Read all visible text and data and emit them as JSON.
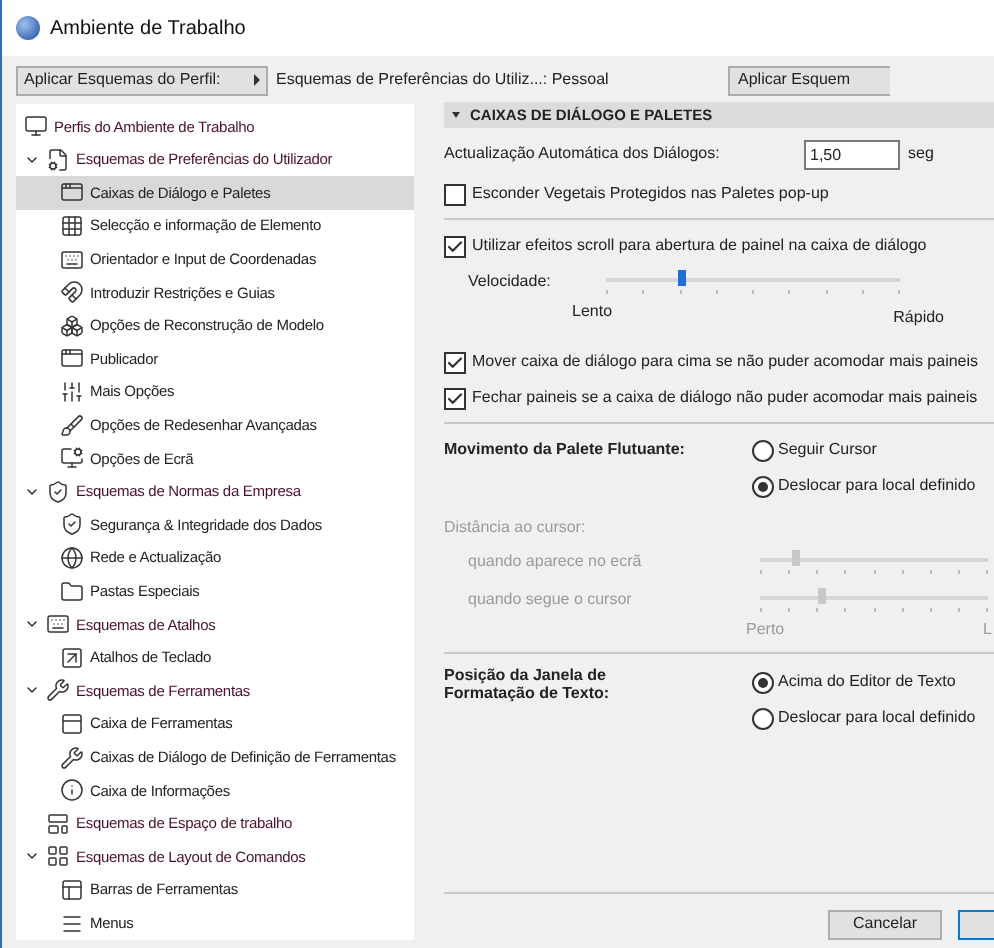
{
  "window": {
    "title": "Ambiente de Trabalho"
  },
  "toolbar": {
    "apply_menu": "Aplicar Esquemas do Perfil:",
    "scheme_path": "Esquemas de Preferências do Utiliz...: Pessoal",
    "apply_button": "Aplicar Esquem"
  },
  "tree": [
    {
      "label": "Perfis do Ambiente de Trabalho",
      "selected": false
    },
    {
      "label": "Esquemas de Preferências do Utilizador",
      "selected": false,
      "expanded": true,
      "children": [
        {
          "label": "Caixas de Diálogo e Paletes",
          "selected": true
        },
        {
          "label": "Selecção e informação de Elemento",
          "selected": false
        },
        {
          "label": "Orientador e Input de Coordenadas",
          "selected": false
        },
        {
          "label": "Introduzir Restrições e Guias",
          "selected": false
        },
        {
          "label": "Opções de Reconstrução de Modelo",
          "selected": false
        },
        {
          "label": "Publicador",
          "selected": false
        },
        {
          "label": "Mais Opções",
          "selected": false
        },
        {
          "label": "Opções de Redesenhar Avançadas",
          "selected": false
        },
        {
          "label": "Opções de Ecrã",
          "selected": false
        }
      ]
    },
    {
      "label": "Esquemas de Normas da Empresa",
      "selected": false,
      "expanded": true,
      "children": [
        {
          "label": "Segurança & Integridade dos Dados",
          "selected": false
        },
        {
          "label": "Rede e Actualização",
          "selected": false
        },
        {
          "label": "Pastas Especiais",
          "selected": false
        }
      ]
    },
    {
      "label": "Esquemas de Atalhos",
      "selected": false,
      "expanded": true,
      "children": [
        {
          "label": "Atalhos de Teclado",
          "selected": false
        }
      ]
    },
    {
      "label": "Esquemas de Ferramentas",
      "selected": false,
      "expanded": true,
      "children": [
        {
          "label": "Caixa de Ferramentas",
          "selected": false
        },
        {
          "label": "Caixas de Diálogo de Definição de Ferramentas",
          "selected": false
        },
        {
          "label": "Caixa de Informações",
          "selected": false
        }
      ]
    },
    {
      "label": "Esquemas de Espaço de trabalho",
      "selected": false
    },
    {
      "label": "Esquemas de Layout de Comandos",
      "selected": false,
      "expanded": true,
      "children": [
        {
          "label": "Barras de Ferramentas",
          "selected": false
        },
        {
          "label": "Menus",
          "selected": false
        }
      ]
    }
  ],
  "section": {
    "title": "CAIXAS DE DIÁLOGO E PALETES",
    "expanded": true
  },
  "auto_update": {
    "label": "Actualização Automática dos Diálogos:",
    "value": "1,50",
    "unit": "seg"
  },
  "hide_vegetation": {
    "label": "Esconder Vegetais Protegidos nas Paletes pop-up",
    "checked": false
  },
  "scroll_effects": {
    "label": "Utilizar efeitos scroll para abertura de painel na caixa de diálogo",
    "checked": true
  },
  "speed": {
    "label": "Velocidade:",
    "level": 0.26,
    "min_label": "Lento",
    "max_label": "Rápido"
  },
  "panel_options": [
    {
      "label": "Mover caixa de diálogo para cima se não puder acomodar mais paineis",
      "checked": true
    },
    {
      "label": "Fechar paineis se a caixa de diálogo não puder acomodar mais paineis",
      "checked": true
    }
  ],
  "floating_palette": {
    "label": "Movimento da Palete Flutuante:",
    "options": [
      {
        "label": "Seguir Cursor",
        "selected": false
      },
      {
        "label": "Deslocar para local definido",
        "selected": true
      }
    ]
  },
  "cursor_distance": {
    "label": "Distância ao cursor:",
    "disabled": true,
    "sliders": [
      {
        "label": "quando aparece no ecrã",
        "level": 0.16
      },
      {
        "label": "quando segue o cursor",
        "level": 0.27
      }
    ],
    "min_label": "Perto",
    "max_label": "L"
  },
  "text_window": {
    "label": "Posição da Janela de Formatação de Texto:",
    "options": [
      {
        "label": "Acima do Editor de Texto",
        "selected": true
      },
      {
        "label": "Deslocar para local definido",
        "selected": false
      }
    ]
  },
  "buttons": [
    "Cancelar"
  ]
}
